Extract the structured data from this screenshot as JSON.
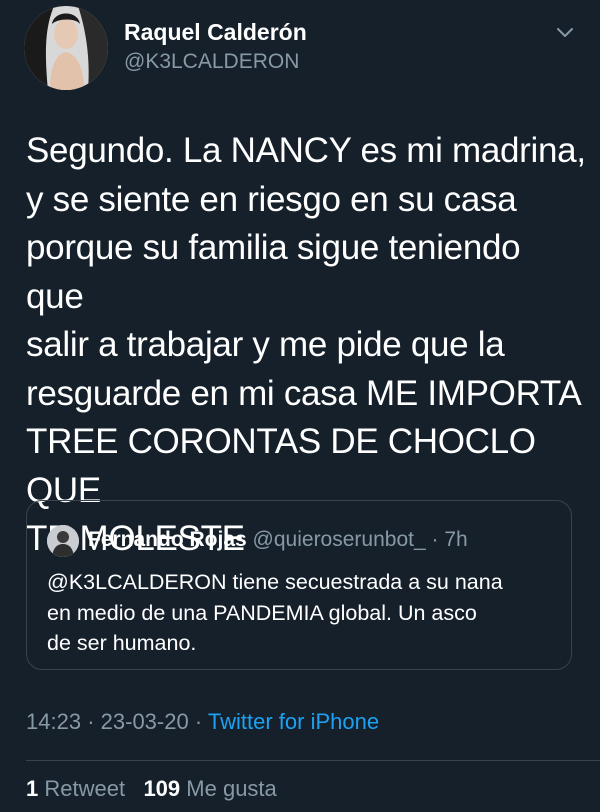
{
  "author": {
    "name": "Raquel Calderón",
    "handle": "@K3LCALDERON"
  },
  "tweet": {
    "text": "Segundo. La NANCY es mi madrina,\ny se siente en riesgo en su casa\nporque su familia sigue teniendo que\nsalir a trabajar y me pide que la\nresguarde en mi casa ME IMPORTA\nTREE CORONTAS DE CHOCLO QUE\nTE MOLESTE"
  },
  "quoted": {
    "name": "Fernando Rojas",
    "handle": "@quieroserunbot_",
    "separator": "·",
    "time": "7h",
    "text": "@K3LCALDERON tiene secuestrada a su nana\nen medio de una PANDEMIA global. Un asco\nde ser humano."
  },
  "meta": {
    "time": "14:23",
    "date": "23-03-20",
    "separator": "·",
    "source": "Twitter for iPhone"
  },
  "stats": {
    "retweets_count": "1",
    "retweets_label": "Retweet",
    "likes_count": "109",
    "likes_label": "Me gusta"
  },
  "colors": {
    "background": "#15202b",
    "text_primary": "#ffffff",
    "text_secondary": "#8899a6",
    "accent": "#1da1f2",
    "border": "#38444d"
  },
  "icons": {
    "more_menu": "chevron-down-icon"
  }
}
